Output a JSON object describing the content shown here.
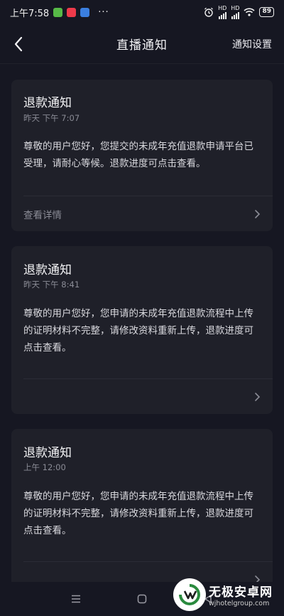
{
  "status_bar": {
    "time": "上午7:58",
    "dots": "···",
    "net1": "HD",
    "net2": "HD",
    "battery": "89"
  },
  "header": {
    "title": "直播通知",
    "settings_label": "通知设置"
  },
  "notifications": [
    {
      "title": "退款通知",
      "time": "昨天 下午 7:07",
      "body": "尊敬的用户您好，您提交的未成年充值退款申请平台已受理，请耐心等候。退款进度可点击查看。",
      "footer_label": "查看详情"
    },
    {
      "title": "退款通知",
      "time": "昨天 下午 8:41",
      "body": "尊敬的用户您好，您申请的未成年充值退款流程中上传的证明材料不完整，请修改资料重新上传，退款进度可点击查看。",
      "footer_label": ""
    },
    {
      "title": "退款通知",
      "time": "上午 12:00",
      "body": "尊敬的用户您好，您申请的未成年充值退款流程中上传的证明材料不完整，请修改资料重新上传，退款进度可点击查看。",
      "footer_label": ""
    }
  ],
  "watermark": {
    "name": "无极安卓网",
    "url": "wjhotelgroup.com"
  },
  "colors": {
    "background": "#161722",
    "card": "#1f2029",
    "muted_text": "#8b8c96"
  },
  "icons": [
    "back-arrow-icon",
    "chevron-right-icon",
    "menu-icon",
    "home-icon",
    "back-triangle-icon",
    "wifi-icon",
    "alarm-icon",
    "battery-icon",
    "signal-icon"
  ]
}
